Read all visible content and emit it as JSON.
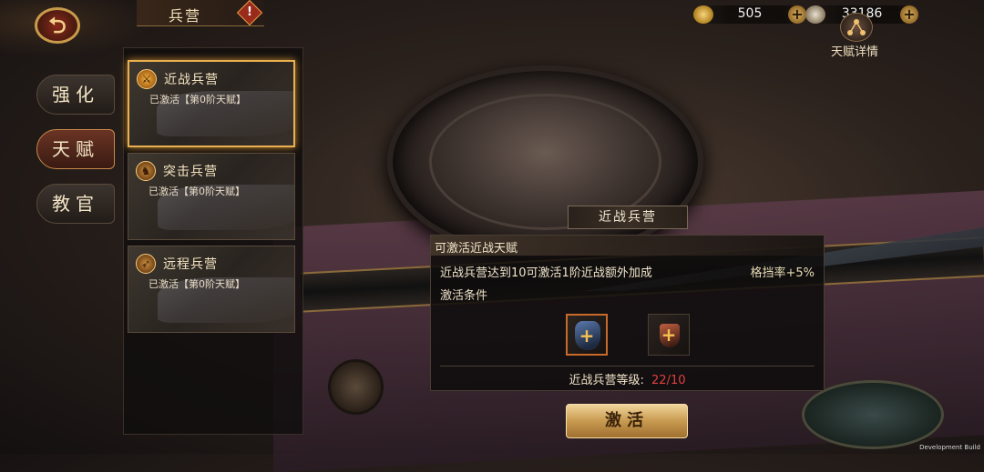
{
  "header": {
    "title": "兵营",
    "alert_glyph": "!",
    "resources": [
      {
        "icon": "gold-ingot-icon",
        "value": "505"
      },
      {
        "icon": "coin-icon",
        "value": "33186"
      }
    ],
    "talent_detail_label": "天赋详情"
  },
  "side_tabs": [
    {
      "label": "强化",
      "active": false
    },
    {
      "label": "天赋",
      "active": true
    },
    {
      "label": "教官",
      "active": false
    }
  ],
  "barracks": [
    {
      "name": "近战兵营",
      "status": "已激活【第0阶天赋】",
      "icon": "sword-icon",
      "selected": true
    },
    {
      "name": "突击兵营",
      "status": "已激活【第0阶天赋】",
      "icon": "horse-icon",
      "selected": false
    },
    {
      "name": "远程兵营",
      "status": "已激活【第0阶天赋】",
      "icon": "bow-icon",
      "selected": false
    }
  ],
  "preview": {
    "label": "近战兵营"
  },
  "talent_panel": {
    "heading": "可激活近战天赋",
    "description": "近战兵营达到10可激活1阶近战额外加成",
    "bonus": "格挡率+5%",
    "condition_label": "激活条件",
    "slots": [
      {
        "icon": "shield-item-icon",
        "plus": "+"
      },
      {
        "icon": "weapon-item-icon",
        "plus": "+"
      }
    ],
    "level_label": "近战兵营等级:",
    "level_value": "22/10"
  },
  "activate_label": "激活",
  "dev_label": "Development Build",
  "colors": {
    "accent_gold": "#e8b050",
    "level_red": "#e04040",
    "active_tab": "#6a3424"
  }
}
